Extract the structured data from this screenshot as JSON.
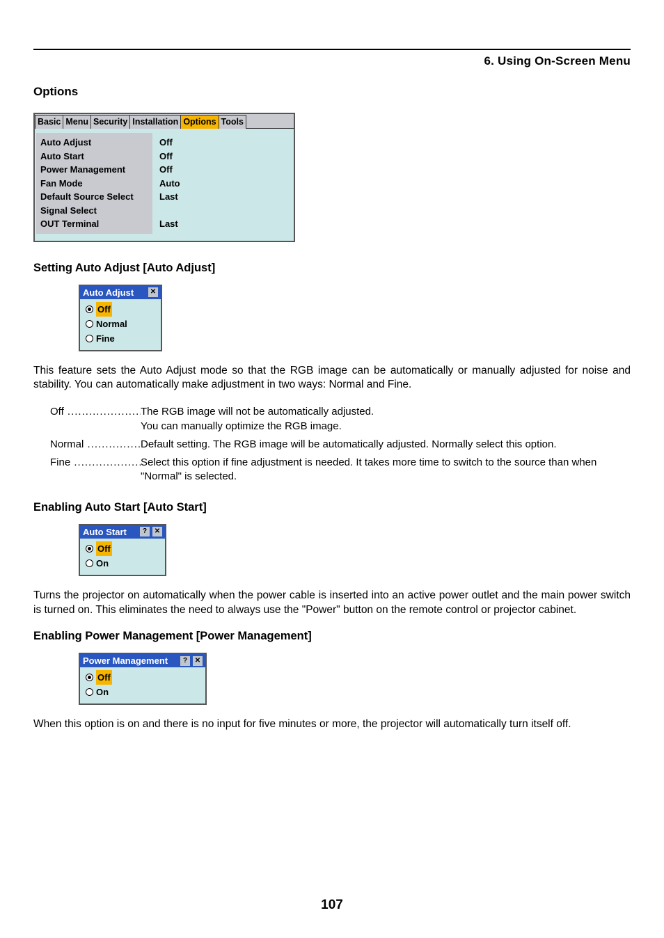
{
  "header": {
    "chapter": "6. Using On-Screen Menu"
  },
  "options_title": "Options",
  "osd": {
    "tabs": [
      "Basic",
      "Menu",
      "Security",
      "Installation",
      "Options",
      "Tools"
    ],
    "selected_tab_index": 4,
    "rows": [
      {
        "label": "Auto Adjust",
        "value": "Off"
      },
      {
        "label": "Auto Start",
        "value": "Off"
      },
      {
        "label": "Power Management",
        "value": "Off"
      },
      {
        "label": "Fan Mode",
        "value": "Auto"
      },
      {
        "label": "Default Source Select",
        "value": "Last"
      },
      {
        "label": "Signal Select",
        "value": ""
      },
      {
        "label": "OUT Terminal",
        "value": "Last"
      }
    ]
  },
  "auto_adjust": {
    "heading": "Setting Auto Adjust [Auto Adjust]",
    "title": "Auto Adjust",
    "opt_off": "Off",
    "opt_normal": "Normal",
    "opt_fine": "Fine",
    "description": "This feature sets the Auto Adjust mode so that the RGB image can be automatically or manually adjusted for noise and stability. You can automatically make adjustment in two ways: Normal and Fine.",
    "defs": {
      "off_term": "Off",
      "off_desc": "The RGB image will not be automatically adjusted.\nYou can manually optimize the RGB image.",
      "normal_term": "Normal",
      "normal_desc": "Default setting. The RGB image will be automatically adjusted. Normally select this option.",
      "fine_term": "Fine",
      "fine_desc": "Select this option if fine adjustment is needed. It takes more time to switch to the source than when \"Normal\" is selected."
    }
  },
  "auto_start": {
    "heading": "Enabling Auto Start [Auto Start]",
    "title": "Auto Start",
    "opt_off": "Off",
    "opt_on": "On",
    "description": "Turns the projector on automatically when the power cable is inserted into an active power outlet and the main power switch is turned on. This eliminates the need to always use the \"Power\" button on the remote control or projector cabinet."
  },
  "power_mgmt": {
    "heading": "Enabling Power Management [Power Management]",
    "title": "Power Management",
    "opt_off": "Off",
    "opt_on": "On",
    "description": "When this option is on and there is no input for five minutes or more, the projector will automatically turn itself off."
  },
  "page_number": "107",
  "icons": {
    "help": "?",
    "close": "✕"
  }
}
